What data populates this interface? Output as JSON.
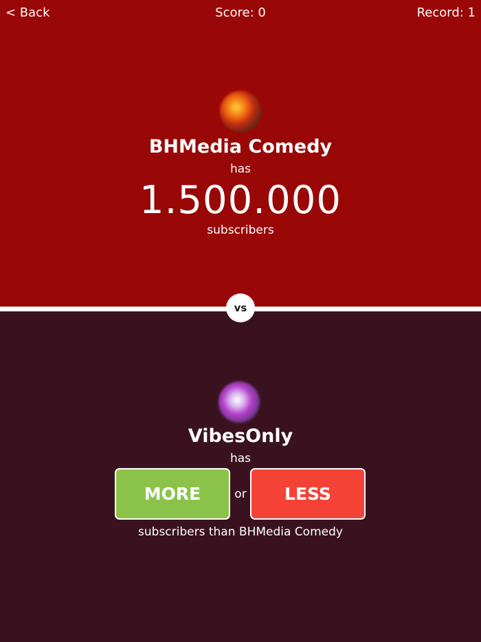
{
  "topbar": {
    "back_label": "< Back",
    "score_text": "Score: 0",
    "record_text": "Record: 1"
  },
  "current": {
    "channel_name": "BHMedia Comedy",
    "has_label": "has",
    "subscriber_count": "1.500.000",
    "unit_label": "subscribers"
  },
  "versus": {
    "label": "vs"
  },
  "challenger": {
    "channel_name": "VibesOnly",
    "has_label": "has",
    "more_label": "MORE",
    "or_label": "or",
    "less_label": "LESS",
    "comparison_text": "subscribers than BHMedia Comedy"
  },
  "colors": {
    "top_panel": "#9a0707",
    "bottom_panel": "#3a121f",
    "more_button": "#8bc34a",
    "less_button": "#f44336"
  }
}
